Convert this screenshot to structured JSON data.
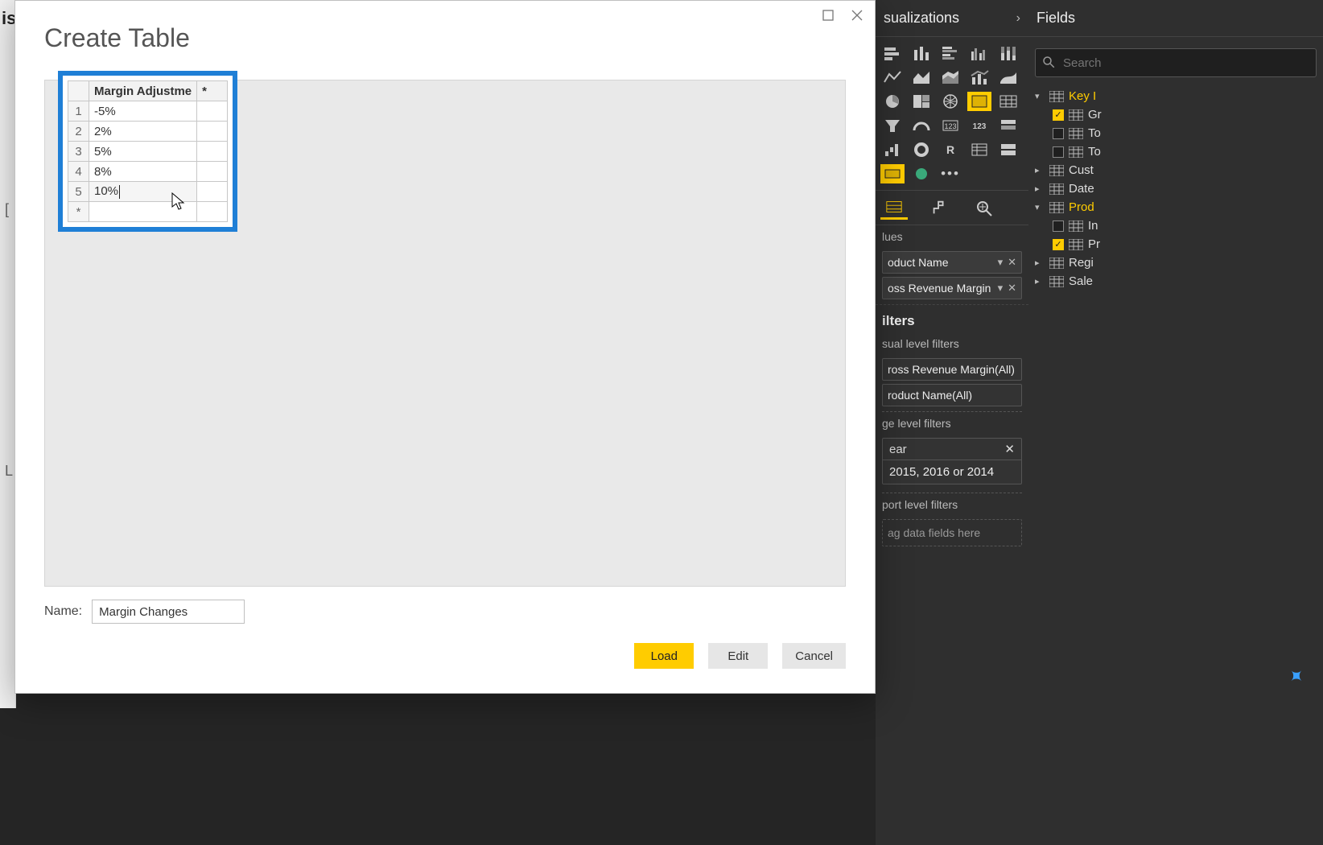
{
  "dialog": {
    "title": "Create Table",
    "name_label": "Name:",
    "name_value": "Margin Changes",
    "buttons": {
      "load": "Load",
      "edit": "Edit",
      "cancel": "Cancel"
    },
    "grid": {
      "header": "Margin Adjustme",
      "new_col_marker": "*",
      "rows": [
        {
          "n": "1",
          "v": "-5%"
        },
        {
          "n": "2",
          "v": "2%"
        },
        {
          "n": "3",
          "v": "5%"
        },
        {
          "n": "4",
          "v": "8%"
        },
        {
          "n": "5",
          "v": "10%"
        }
      ],
      "new_row_marker": "*"
    }
  },
  "viz": {
    "title": "sualizations",
    "sections": {
      "values_label": "lues",
      "filters_heading": "ilters",
      "visual_filters_label": "sual level filters",
      "page_filters_label": "ge level filters",
      "report_filters_label": "port level filters",
      "drag_placeholder": "ag data fields here"
    },
    "value_chips": [
      {
        "label": "oduct Name"
      },
      {
        "label": "oss Revenue Margin"
      }
    ],
    "visual_filters": [
      {
        "label": "ross Revenue Margin(All)"
      },
      {
        "label": "roduct Name(All)"
      }
    ],
    "page_filter": {
      "header": "ear",
      "body": "2015, 2016 or 2014"
    }
  },
  "fields": {
    "title": "Fields",
    "search_placeholder": "Search",
    "tree": [
      {
        "type": "table",
        "expanded": true,
        "label": "Key I",
        "highlight": true,
        "children": [
          {
            "checked": true,
            "label": "Gr"
          },
          {
            "checked": false,
            "label": "To"
          },
          {
            "checked": false,
            "label": "To"
          }
        ]
      },
      {
        "type": "table",
        "expanded": false,
        "label": "Cust"
      },
      {
        "type": "table",
        "expanded": false,
        "label": "Date"
      },
      {
        "type": "table",
        "expanded": true,
        "label": "Prod",
        "highlight": true,
        "children": [
          {
            "checked": false,
            "label": "In"
          },
          {
            "checked": true,
            "label": "Pr"
          }
        ]
      },
      {
        "type": "table",
        "expanded": false,
        "label": "Regi"
      },
      {
        "type": "table",
        "expanded": false,
        "label": "Sale"
      }
    ]
  }
}
